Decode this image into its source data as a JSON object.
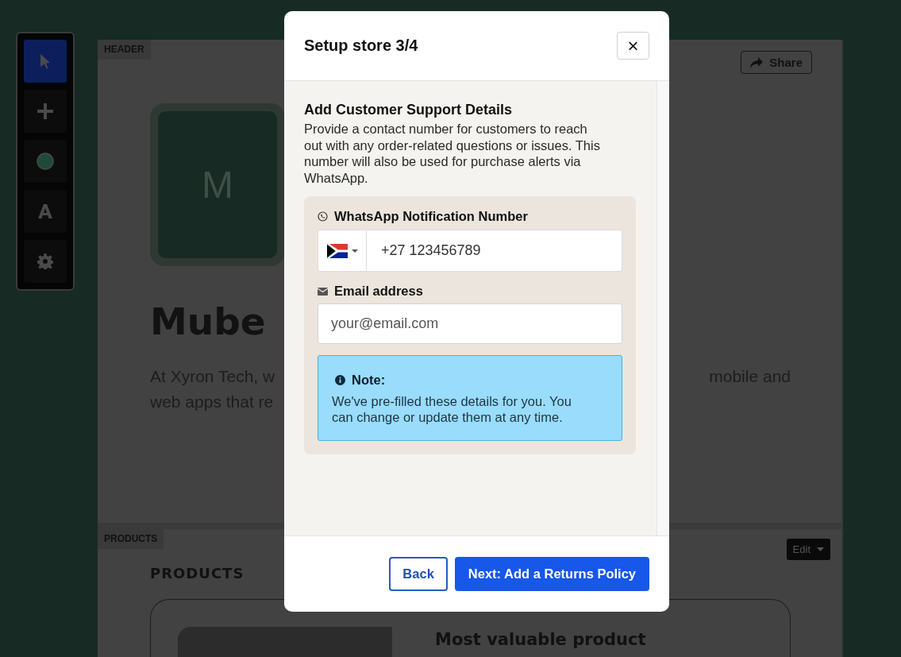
{
  "toolbar": {
    "tools": [
      {
        "kind": "pointer",
        "selected": true
      },
      {
        "kind": "add",
        "selected": false
      },
      {
        "kind": "shape",
        "selected": false
      },
      {
        "kind": "text",
        "selected": false
      },
      {
        "kind": "settings",
        "selected": false
      }
    ]
  },
  "header_section": {
    "label": "HEADER",
    "share_button": "Share",
    "logo_letter": "M",
    "title": "Mube",
    "intro_left": [
      "At Xyron Tech, w",
      "web apps that re"
    ],
    "intro_right": [
      "mobile and"
    ]
  },
  "products_section": {
    "label": "PRODUCTS",
    "heading": "PRODUCTS",
    "edit_button": "Edit",
    "card": {
      "title": "Most valuable product"
    }
  },
  "dialog": {
    "title": "Setup store 3/4",
    "close": "×",
    "heading": "Add Customer Support Details",
    "description": "Provide a contact number for customers to reach out with any order-related questions or issues. This number will also be used for purchase alerts via WhatsApp.",
    "phone": {
      "label": "WhatsApp Notification Number",
      "value": "+27 123456789"
    },
    "email": {
      "label": "Email address",
      "placeholder": "your@email.com"
    },
    "note": {
      "title": "Note:",
      "text": "We've pre-filled these details for you. You can change or update them at any time."
    },
    "buttons": [
      {
        "kind": "secondary",
        "label": "Back"
      },
      {
        "kind": "primary",
        "label": "Next: Add a Returns Policy"
      }
    ]
  }
}
